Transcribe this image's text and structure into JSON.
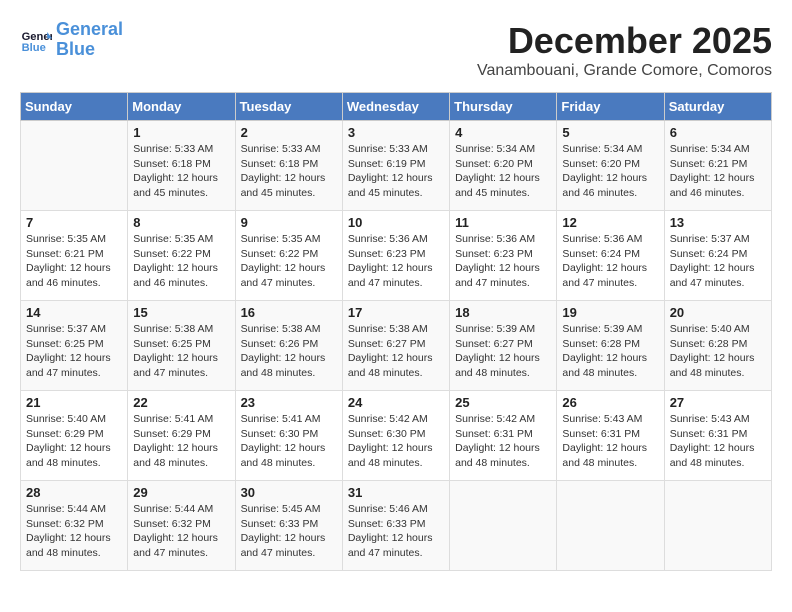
{
  "header": {
    "logo_line1": "General",
    "logo_line2": "Blue",
    "month_title": "December 2025",
    "subtitle": "Vanambouani, Grande Comore, Comoros"
  },
  "days_of_week": [
    "Sunday",
    "Monday",
    "Tuesday",
    "Wednesday",
    "Thursday",
    "Friday",
    "Saturday"
  ],
  "weeks": [
    [
      {
        "day": "",
        "info": ""
      },
      {
        "day": "1",
        "info": "Sunrise: 5:33 AM\nSunset: 6:18 PM\nDaylight: 12 hours\nand 45 minutes."
      },
      {
        "day": "2",
        "info": "Sunrise: 5:33 AM\nSunset: 6:18 PM\nDaylight: 12 hours\nand 45 minutes."
      },
      {
        "day": "3",
        "info": "Sunrise: 5:33 AM\nSunset: 6:19 PM\nDaylight: 12 hours\nand 45 minutes."
      },
      {
        "day": "4",
        "info": "Sunrise: 5:34 AM\nSunset: 6:20 PM\nDaylight: 12 hours\nand 45 minutes."
      },
      {
        "day": "5",
        "info": "Sunrise: 5:34 AM\nSunset: 6:20 PM\nDaylight: 12 hours\nand 46 minutes."
      },
      {
        "day": "6",
        "info": "Sunrise: 5:34 AM\nSunset: 6:21 PM\nDaylight: 12 hours\nand 46 minutes."
      }
    ],
    [
      {
        "day": "7",
        "info": "Sunrise: 5:35 AM\nSunset: 6:21 PM\nDaylight: 12 hours\nand 46 minutes."
      },
      {
        "day": "8",
        "info": "Sunrise: 5:35 AM\nSunset: 6:22 PM\nDaylight: 12 hours\nand 46 minutes."
      },
      {
        "day": "9",
        "info": "Sunrise: 5:35 AM\nSunset: 6:22 PM\nDaylight: 12 hours\nand 47 minutes."
      },
      {
        "day": "10",
        "info": "Sunrise: 5:36 AM\nSunset: 6:23 PM\nDaylight: 12 hours\nand 47 minutes."
      },
      {
        "day": "11",
        "info": "Sunrise: 5:36 AM\nSunset: 6:23 PM\nDaylight: 12 hours\nand 47 minutes."
      },
      {
        "day": "12",
        "info": "Sunrise: 5:36 AM\nSunset: 6:24 PM\nDaylight: 12 hours\nand 47 minutes."
      },
      {
        "day": "13",
        "info": "Sunrise: 5:37 AM\nSunset: 6:24 PM\nDaylight: 12 hours\nand 47 minutes."
      }
    ],
    [
      {
        "day": "14",
        "info": "Sunrise: 5:37 AM\nSunset: 6:25 PM\nDaylight: 12 hours\nand 47 minutes."
      },
      {
        "day": "15",
        "info": "Sunrise: 5:38 AM\nSunset: 6:25 PM\nDaylight: 12 hours\nand 47 minutes."
      },
      {
        "day": "16",
        "info": "Sunrise: 5:38 AM\nSunset: 6:26 PM\nDaylight: 12 hours\nand 48 minutes."
      },
      {
        "day": "17",
        "info": "Sunrise: 5:38 AM\nSunset: 6:27 PM\nDaylight: 12 hours\nand 48 minutes."
      },
      {
        "day": "18",
        "info": "Sunrise: 5:39 AM\nSunset: 6:27 PM\nDaylight: 12 hours\nand 48 minutes."
      },
      {
        "day": "19",
        "info": "Sunrise: 5:39 AM\nSunset: 6:28 PM\nDaylight: 12 hours\nand 48 minutes."
      },
      {
        "day": "20",
        "info": "Sunrise: 5:40 AM\nSunset: 6:28 PM\nDaylight: 12 hours\nand 48 minutes."
      }
    ],
    [
      {
        "day": "21",
        "info": "Sunrise: 5:40 AM\nSunset: 6:29 PM\nDaylight: 12 hours\nand 48 minutes."
      },
      {
        "day": "22",
        "info": "Sunrise: 5:41 AM\nSunset: 6:29 PM\nDaylight: 12 hours\nand 48 minutes."
      },
      {
        "day": "23",
        "info": "Sunrise: 5:41 AM\nSunset: 6:30 PM\nDaylight: 12 hours\nand 48 minutes."
      },
      {
        "day": "24",
        "info": "Sunrise: 5:42 AM\nSunset: 6:30 PM\nDaylight: 12 hours\nand 48 minutes."
      },
      {
        "day": "25",
        "info": "Sunrise: 5:42 AM\nSunset: 6:31 PM\nDaylight: 12 hours\nand 48 minutes."
      },
      {
        "day": "26",
        "info": "Sunrise: 5:43 AM\nSunset: 6:31 PM\nDaylight: 12 hours\nand 48 minutes."
      },
      {
        "day": "27",
        "info": "Sunrise: 5:43 AM\nSunset: 6:31 PM\nDaylight: 12 hours\nand 48 minutes."
      }
    ],
    [
      {
        "day": "28",
        "info": "Sunrise: 5:44 AM\nSunset: 6:32 PM\nDaylight: 12 hours\nand 48 minutes."
      },
      {
        "day": "29",
        "info": "Sunrise: 5:44 AM\nSunset: 6:32 PM\nDaylight: 12 hours\nand 47 minutes."
      },
      {
        "day": "30",
        "info": "Sunrise: 5:45 AM\nSunset: 6:33 PM\nDaylight: 12 hours\nand 47 minutes."
      },
      {
        "day": "31",
        "info": "Sunrise: 5:46 AM\nSunset: 6:33 PM\nDaylight: 12 hours\nand 47 minutes."
      },
      {
        "day": "",
        "info": ""
      },
      {
        "day": "",
        "info": ""
      },
      {
        "day": "",
        "info": ""
      }
    ]
  ]
}
